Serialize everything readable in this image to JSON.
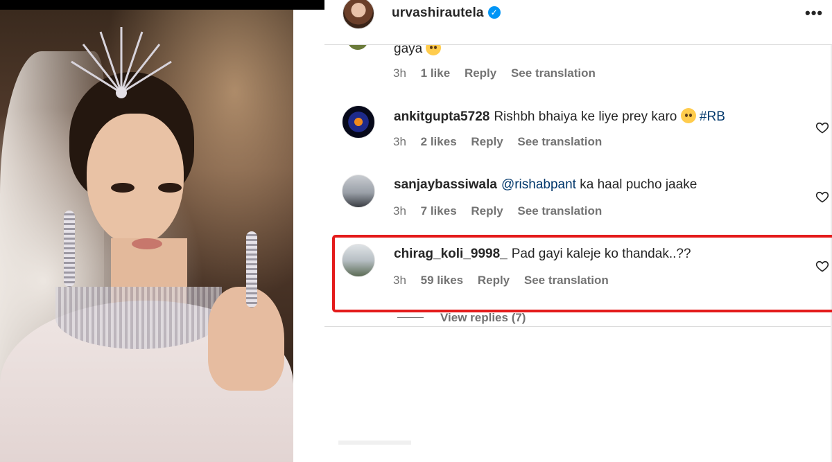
{
  "post": {
    "author": "urvashirautela",
    "verified_icon": "verified-badge-icon",
    "more_icon": "more-options-icon"
  },
  "partial_comment": {
    "text": "gaya",
    "time": "3h",
    "likes": "1 like",
    "reply": "Reply",
    "translate": "See translation"
  },
  "comments": [
    {
      "user": "ankitgupta5728",
      "text_before": "Rishbh bhaiya ke liye prey karo ",
      "mention": "#RB",
      "time": "3h",
      "likes": "2 likes",
      "reply": "Reply",
      "translate": "See translation"
    },
    {
      "user": "sanjaybassiwala",
      "mention": "@rishabpant",
      "text_after": " ka haal pucho jaake",
      "time": "3h",
      "likes": "7 likes",
      "reply": "Reply",
      "translate": "See translation"
    },
    {
      "user": "chirag_koli_9998_",
      "text": "Pad gayi kaleje ko thandak..??",
      "time": "3h",
      "likes": "59 likes",
      "reply": "Reply",
      "translate": "See translation"
    }
  ],
  "view_replies": "View replies (7)",
  "colors": {
    "highlight_border": "#e41b1b",
    "mention": "#00376b",
    "meta_text": "#737373",
    "verified": "#0095f6"
  }
}
